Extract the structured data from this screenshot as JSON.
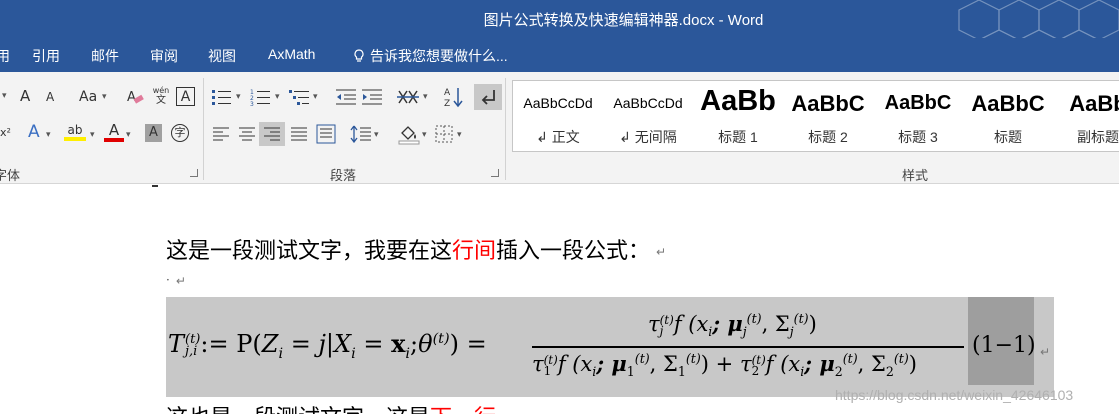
{
  "window": {
    "title": "图片公式转换及快速编辑神器.docx - Word"
  },
  "menu": {
    "tabs": [
      {
        "label": "引用"
      },
      {
        "label": "邮件"
      },
      {
        "label": "审阅"
      },
      {
        "label": "视图"
      },
      {
        "label": "AxMath"
      }
    ],
    "tell_me": "告诉我您想要做什么..."
  },
  "ribbon": {
    "groups": {
      "font": "字体",
      "paragraph": "段落",
      "styles": "样式"
    },
    "font_buttons": {
      "grow": "A",
      "shrink": "A",
      "change_case": "Aa",
      "phonetic": "wén文",
      "border_char": "A",
      "text_effect": "A",
      "highlight": "ab",
      "font_color": "A",
      "char_shade": "A",
      "enclose": "字"
    },
    "styles": [
      {
        "sample": "AaBbCcDd",
        "name": "↲ 正文"
      },
      {
        "sample": "AaBbCcDd",
        "name": "↲ 无间隔"
      },
      {
        "sample": "AaBb",
        "name": "标题 1"
      },
      {
        "sample": "AaBbC",
        "name": "标题 2"
      },
      {
        "sample": "AaBbC",
        "name": "标题 3"
      },
      {
        "sample": "AaBbC",
        "name": "标题"
      },
      {
        "sample": "AaBb",
        "name": "副标题"
      }
    ]
  },
  "document": {
    "line1": {
      "before": "这是一段测试文字，我要在这",
      "red": "行间",
      "after": "插入一段公式：",
      "mark": "↵"
    },
    "line2": {
      "dot": "·",
      "mark": "↵"
    },
    "equation": {
      "lhs_var": "T",
      "lhs_sup": "(t)",
      "lhs_sub": "j,i",
      "assign": ":=",
      "prob": "P",
      "open": "(",
      "z": "Z",
      "z_sub": "i",
      "eq1": "=",
      "j": "j",
      "bar": "|",
      "x": "X",
      "x_sub": "i",
      "eq2": "=",
      "xb": "x",
      "xb_sub": "i",
      "semi": ";",
      "theta": "θ",
      "theta_sup": "(t)",
      "close": ")",
      "eq3": "=",
      "numerator": "τ",
      "num_sup": "(t)",
      "num_sub": "j",
      "num_rest": "f (x",
      "num_rest2": "; μ",
      "num_rest3": ", Σ",
      "num_close": ")",
      "denominator_1": "τ",
      "den1_sup": "(t)",
      "den1_sub": "1",
      "den_f1": "f (x",
      "den_mu1": "; μ",
      "den_sig1": ", Σ",
      "den_close1": ")",
      "plus": "+",
      "denominator_2": "τ",
      "den2_sup": "(t)",
      "den2_sub": "2",
      "den_f2": "f (x",
      "den_mu2": "; μ",
      "den_sig2": ", Σ",
      "den_close2": ")",
      "number": "(1−1)",
      "mark": "↵"
    },
    "line3": {
      "before": "这也是一段测试文字，这是",
      "red": "下一行"
    },
    "watermark": "https://blog.csdn.net/weixin_42646103"
  },
  "colors": {
    "brand": "#2b579a",
    "ribbon": "#f3f3f3",
    "red_text": "#ff0000",
    "equation_bg": "#c8c8c8",
    "number_bg": "#9e9e9e"
  }
}
